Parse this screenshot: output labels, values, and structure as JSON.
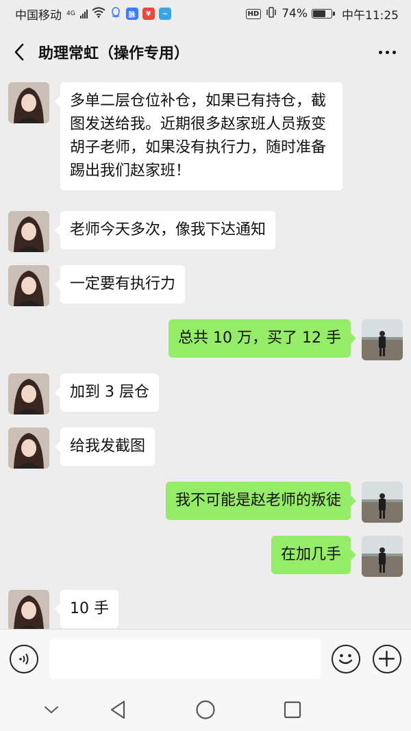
{
  "status_bar": {
    "carrier": "中国移动",
    "network": "4G",
    "battery_percent": "74%",
    "battery_level": 0.74,
    "time": "中午11:25",
    "hd_label": "HD",
    "app_icons": [
      "qq-icon",
      "maimai-icon",
      "stock-app-icon",
      "bird-app-icon"
    ],
    "maimai_label": "脉"
  },
  "header": {
    "title": "助理常虹（操作专用）",
    "back_icon": "chevron-left-icon",
    "more_icon": "more-dots-icon"
  },
  "messages": [
    {
      "side": "left",
      "text": "多单二层仓位补仓，如果已有持仓，截图发送给我。近期很多赵家班人员叛变胡子老师，如果没有执行力，随时准备踢出我们赵家班！"
    },
    {
      "side": "left",
      "text": "老师今天多次，像我下达通知"
    },
    {
      "side": "left",
      "text": "一定要有执行力"
    },
    {
      "side": "right",
      "text": "总共 10 万，买了 12 手"
    },
    {
      "side": "left",
      "text": "加到 3 层仓"
    },
    {
      "side": "left",
      "text": "给我发截图"
    },
    {
      "side": "right",
      "text": "我不可能是赵老师的叛徒"
    },
    {
      "side": "right",
      "text": "在加几手"
    },
    {
      "side": "left",
      "text": "10 手"
    }
  ],
  "input_bar": {
    "voice_icon": "voice-icon",
    "emoji_icon": "emoji-icon",
    "plus_icon": "plus-icon",
    "input_value": ""
  },
  "nav_bar": {
    "icons": [
      "nav-collapse-icon",
      "nav-back-icon",
      "nav-home-icon",
      "nav-recents-icon"
    ]
  },
  "colors": {
    "background": "#ededed",
    "sent_bubble": "#95ec69",
    "received_bubble": "#ffffff"
  }
}
